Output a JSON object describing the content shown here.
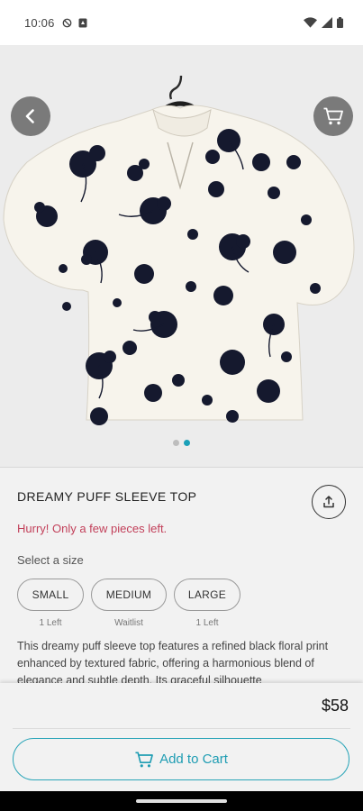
{
  "status_bar": {
    "time": "10:06"
  },
  "product": {
    "title": "DREAMY PUFF SLEEVE TOP",
    "stock_message": "Hurry! Only a few pieces left.",
    "size_label": "Select a size",
    "sizes": [
      {
        "label": "SMALL",
        "note": "1 Left"
      },
      {
        "label": "MEDIUM",
        "note": "Waitlist"
      },
      {
        "label": "LARGE",
        "note": "1 Left"
      }
    ],
    "description": "This dreamy puff sleeve top features a refined black floral print enhanced by textured fabric, offering a harmonious blend of elegance and subtle depth. Its graceful silhouette",
    "price": "$58",
    "image_count": 2,
    "active_image": 2
  },
  "actions": {
    "add_to_cart": "Add to Cart"
  },
  "colors": {
    "accent": "#1ba0b8",
    "stock_warning": "#c2405a",
    "hero_bg": "#ececec",
    "panel_bg": "#f2f2f2"
  },
  "icons": {
    "back": "arrow-left-icon",
    "cart": "cart-icon",
    "share": "share-icon"
  }
}
